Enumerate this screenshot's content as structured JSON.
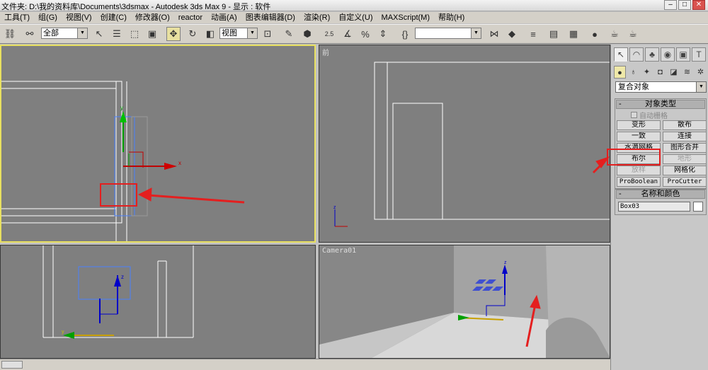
{
  "window": {
    "title": "文件夹: D:\\我的资料库\\Documents\\3dsmax    - Autodesk 3ds Max 9    - 显示 : 软件",
    "controls": [
      "–",
      "□",
      "✕"
    ]
  },
  "menu": [
    "工具(T)",
    "组(G)",
    "视图(V)",
    "创建(C)",
    "修改器(O)",
    "reactor",
    "动画(A)",
    "图表编辑器(D)",
    "渲染(R)",
    "自定义(U)",
    "MAXScript(M)",
    "帮助(H)"
  ],
  "toolbar": {
    "selection_filter": "全部",
    "reference_coord": "视图",
    "snap_value": "2.5",
    "named_selection": ""
  },
  "viewports": {
    "top_right_label": "前",
    "bottom_right_label": "Camera01",
    "axis_x": "x",
    "axis_y": "y",
    "axis_z": "z"
  },
  "command_panel": {
    "category": "复合对象",
    "object_type_header": "对象类型",
    "auto_grid_label": "自动栅格",
    "buttons": [
      {
        "label": "变形",
        "enabled": true
      },
      {
        "label": "散布",
        "enabled": true
      },
      {
        "label": "一致",
        "enabled": true
      },
      {
        "label": "连接",
        "enabled": true
      },
      {
        "label": "水滴网格",
        "enabled": true
      },
      {
        "label": "图形合并",
        "enabled": true
      },
      {
        "label": "布尔",
        "enabled": true
      },
      {
        "label": "地形",
        "enabled": false
      },
      {
        "label": "放样",
        "enabled": false
      },
      {
        "label": "网格化",
        "enabled": true
      },
      {
        "label": "ProBoolean",
        "enabled": true
      },
      {
        "label": "ProCutter",
        "enabled": true
      }
    ],
    "name_color_header": "名称和颜色",
    "object_name": "Box03",
    "object_color": "#ffffff"
  },
  "colors": {
    "viewport_bg": "#7f7f7f",
    "active_border": "#e8e060",
    "annotation_red": "#e41f1f",
    "gizmo_x": "#d00000",
    "gizmo_y": "#00a000",
    "gizmo_z": "#0000c8"
  }
}
